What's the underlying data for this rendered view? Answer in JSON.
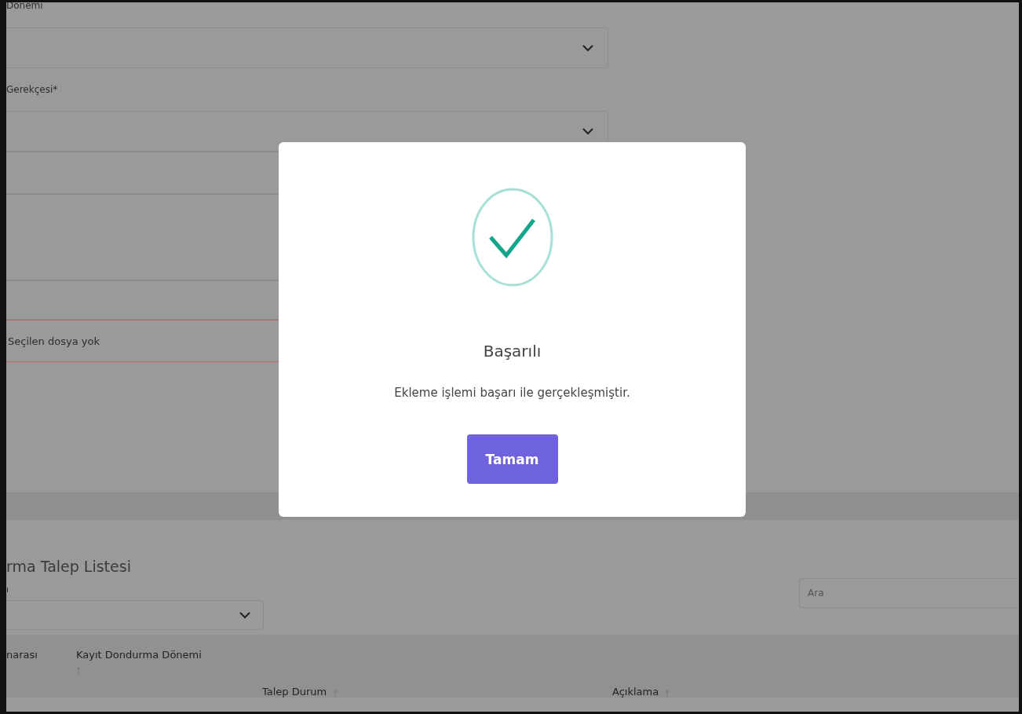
{
  "form": {
    "fields": [
      {
        "kind": "select",
        "label": "Dönemi"
      },
      {
        "kind": "select",
        "label": "Gerekçesi*"
      },
      {
        "kind": "input"
      },
      {
        "kind": "textarea"
      },
      {
        "kind": "input"
      },
      {
        "kind": "file",
        "value": "Seçilen dosya yok",
        "invalid": true
      }
    ]
  },
  "list": {
    "title": "rma Talep Listesi",
    "filter": {
      "label": "ı"
    },
    "search": {
      "placeholder": "Ara"
    },
    "columns": [
      {
        "label": "narası",
        "sortable": false
      },
      {
        "label": "Kayıt Dondurma Dönemi",
        "sortable": true
      },
      {
        "label": "Talep Durum",
        "sortable": true
      },
      {
        "label": "Açıklama",
        "sortable": true
      }
    ]
  },
  "dialog": {
    "title": "Başarılı",
    "message": "Ekleme işlemi başarı ile gerçekleşmiştir.",
    "button": "Tamam"
  }
}
